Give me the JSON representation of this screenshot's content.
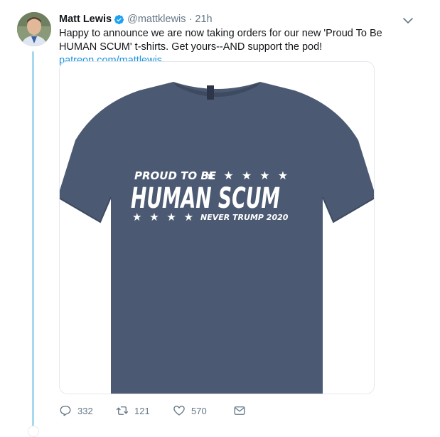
{
  "tweet": {
    "author_name": "Matt Lewis",
    "handle": "@mattklewis",
    "separator": "·",
    "time": "21h",
    "text_main": "Happy to announce we are now taking orders for our new 'Proud To Be HUMAN SCUM' t-shirts.  Get yours--AND support the pod! ",
    "text_link": "patreon.com/mattlewis",
    "verified_icon": "verified-badge-icon",
    "caret_icon": "chevron-down-icon"
  },
  "shirt": {
    "line1": "PROUD TO BE",
    "line2": "HUMAN SCUM",
    "line3": "NEVER TRUMP 2020",
    "stars": "★ ★ ★ ★ ★",
    "stars_left": "★ ★ ★ ★",
    "shirt_color": "#4b5a72",
    "print_color": "#ffffff"
  },
  "actions": {
    "reply_count": "332",
    "retweet_count": "121",
    "like_count": "570",
    "icons": [
      "reply-icon",
      "retweet-icon",
      "like-icon",
      "direct-message-icon"
    ]
  },
  "colors": {
    "link": "#1b95e0",
    "muted": "#657786",
    "thread_line": "#a8d8ee"
  }
}
